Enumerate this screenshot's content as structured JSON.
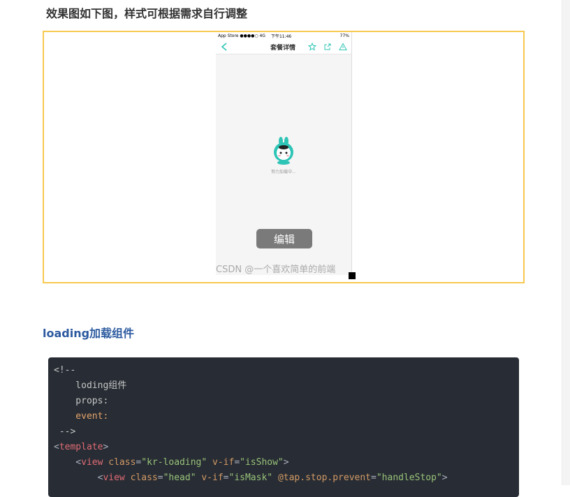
{
  "intro_text": "效果图如下图，样式可根据需求自行调整",
  "phone": {
    "status_left": "App Store ●●●●○ 4G",
    "status_time": "下午11:46",
    "status_right": "77%",
    "nav_title": "套餐详情",
    "loading_text": "努力加载中...",
    "edit_button": "编辑",
    "watermark": "CSDN @一个喜欢简单的前端"
  },
  "section_heading": "loading加载组件",
  "code": {
    "line1": "<!--",
    "line2": "    loding组件",
    "line3": "    props:",
    "line4": "    event:",
    "line5": " -->",
    "line6_open": "<",
    "line6_tag": "template",
    "line6_close": ">",
    "line7_indent": "    <",
    "line7_tag": "view",
    "line7_attr1": " class",
    "line7_eq1": "=",
    "line7_val1": "\"kr-loading\"",
    "line7_attr2": " v-if",
    "line7_eq2": "=",
    "line7_val2": "\"isShow\"",
    "line7_close": ">",
    "line8_indent": "        <",
    "line8_tag": "view",
    "line8_attr1": " class",
    "line8_eq1": "=",
    "line8_val1": "\"head\"",
    "line8_attr2": " v-if",
    "line8_eq2": "=",
    "line8_val2": "\"isMask\"",
    "line8_attr3": " @tap.stop.prevent",
    "line8_eq3": "=",
    "line8_val3": "\"handleStop\"",
    "line8_close": ">"
  },
  "colors": {
    "frame_border": "#f7c94f",
    "heading": "#2c5aa0",
    "code_bg": "#282c34",
    "accent_teal": "#2ec4b6"
  }
}
